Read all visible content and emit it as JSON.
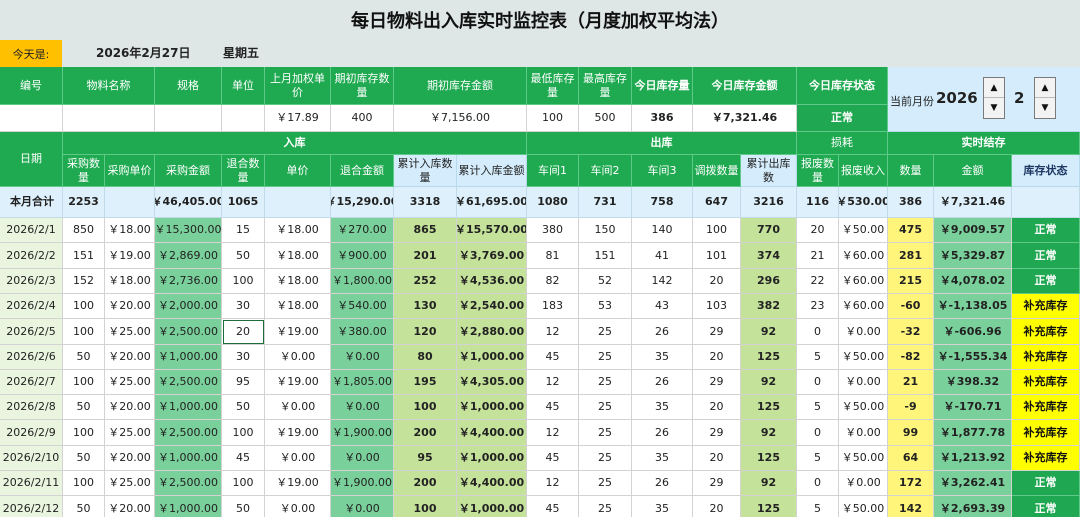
{
  "title": "每日物料出入库实时监控表（月度加权平均法）",
  "today": {
    "label": "今天是:",
    "date": "2026年2月27日",
    "weekday": "星期五"
  },
  "info_header": [
    "编号",
    "物料名称",
    "规格",
    "单位",
    "上月加权单价",
    "期初库存数量",
    "期初库存金额",
    "最低库存量",
    "最高库存量",
    "今日库存量",
    "今日库存金额",
    "今日库存状态"
  ],
  "info_values": [
    "",
    "",
    "",
    "",
    "￥17.89",
    "400",
    "￥7,156.00",
    "100",
    "500",
    "386",
    "￥7,321.46",
    "正常"
  ],
  "month_panel": {
    "label": "当前月份",
    "year": "2026",
    "month": "2",
    "up_icon": "spin-up-icon",
    "down_icon": "spin-down-icon"
  },
  "groups": {
    "date": "日期",
    "inbound": "入库",
    "outbound": "出库",
    "loss": "损耗",
    "stock": "实时结存"
  },
  "sub_header": [
    "采购数量",
    "采购单价",
    "采购金额",
    "退合数量",
    "单价",
    "退合金额",
    "累计入库数量",
    "累计入库金额",
    "车间1",
    "车间2",
    "车间3",
    "调拨数量",
    "累计出库数",
    "报废数量",
    "报废收入",
    "数量",
    "金额",
    "库存状态"
  ],
  "total_row": [
    "本月合计",
    "2253",
    "",
    "￥46,405.00",
    "1065",
    "",
    "￥15,290.00",
    "3318",
    "￥61,695.00",
    "1080",
    "731",
    "758",
    "647",
    "3216",
    "116",
    "￥530.00",
    "386",
    "￥7,321.46",
    ""
  ],
  "rows": [
    [
      "2026/2/1",
      "850",
      "￥18.00",
      "￥15,300.00",
      "15",
      "￥18.00",
      "￥270.00",
      "865",
      "￥15,570.00",
      "380",
      "150",
      "140",
      "100",
      "770",
      "20",
      "￥50.00",
      "475",
      "￥9,009.57",
      "正常"
    ],
    [
      "2026/2/2",
      "151",
      "￥19.00",
      "￥2,869.00",
      "50",
      "￥18.00",
      "￥900.00",
      "201",
      "￥3,769.00",
      "81",
      "151",
      "41",
      "101",
      "374",
      "21",
      "￥60.00",
      "281",
      "￥5,329.87",
      "正常"
    ],
    [
      "2026/2/3",
      "152",
      "￥18.00",
      "￥2,736.00",
      "100",
      "￥18.00",
      "￥1,800.00",
      "252",
      "￥4,536.00",
      "82",
      "52",
      "142",
      "20",
      "296",
      "22",
      "￥60.00",
      "215",
      "￥4,078.02",
      "正常"
    ],
    [
      "2026/2/4",
      "100",
      "￥20.00",
      "￥2,000.00",
      "30",
      "￥18.00",
      "￥540.00",
      "130",
      "￥2,540.00",
      "183",
      "53",
      "43",
      "103",
      "382",
      "23",
      "￥60.00",
      "-60",
      "￥-1,138.05",
      "补充库存"
    ],
    [
      "2026/2/5",
      "100",
      "￥25.00",
      "￥2,500.00",
      "20",
      "￥19.00",
      "￥380.00",
      "120",
      "￥2,880.00",
      "12",
      "25",
      "26",
      "29",
      "92",
      "0",
      "￥0.00",
      "-32",
      "￥-606.96",
      "补充库存"
    ],
    [
      "2026/2/6",
      "50",
      "￥20.00",
      "￥1,000.00",
      "30",
      "￥0.00",
      "￥0.00",
      "80",
      "￥1,000.00",
      "45",
      "25",
      "35",
      "20",
      "125",
      "5",
      "￥50.00",
      "-82",
      "￥-1,555.34",
      "补充库存"
    ],
    [
      "2026/2/7",
      "100",
      "￥25.00",
      "￥2,500.00",
      "95",
      "￥19.00",
      "￥1,805.00",
      "195",
      "￥4,305.00",
      "12",
      "25",
      "26",
      "29",
      "92",
      "0",
      "￥0.00",
      "21",
      "￥398.32",
      "补充库存"
    ],
    [
      "2026/2/8",
      "50",
      "￥20.00",
      "￥1,000.00",
      "50",
      "￥0.00",
      "￥0.00",
      "100",
      "￥1,000.00",
      "45",
      "25",
      "35",
      "20",
      "125",
      "5",
      "￥50.00",
      "-9",
      "￥-170.71",
      "补充库存"
    ],
    [
      "2026/2/9",
      "100",
      "￥25.00",
      "￥2,500.00",
      "100",
      "￥19.00",
      "￥1,900.00",
      "200",
      "￥4,400.00",
      "12",
      "25",
      "26",
      "29",
      "92",
      "0",
      "￥0.00",
      "99",
      "￥1,877.78",
      "补充库存"
    ],
    [
      "2026/2/10",
      "50",
      "￥20.00",
      "￥1,000.00",
      "45",
      "￥0.00",
      "￥0.00",
      "95",
      "￥1,000.00",
      "45",
      "25",
      "35",
      "20",
      "125",
      "5",
      "￥50.00",
      "64",
      "￥1,213.92",
      "补充库存"
    ],
    [
      "2026/2/11",
      "100",
      "￥25.00",
      "￥2,500.00",
      "100",
      "￥19.00",
      "￥1,900.00",
      "200",
      "￥4,400.00",
      "12",
      "25",
      "26",
      "29",
      "92",
      "0",
      "￥0.00",
      "172",
      "￥3,262.41",
      "正常"
    ],
    [
      "2026/2/12",
      "50",
      "￥20.00",
      "￥1,000.00",
      "50",
      "￥0.00",
      "￥0.00",
      "100",
      "￥1,000.00",
      "45",
      "25",
      "35",
      "20",
      "125",
      "5",
      "￥50.00",
      "142",
      "￥2,693.39",
      "正常"
    ]
  ],
  "colors": {
    "header_green": "#1faa51",
    "light_blue": "#d4ecfb",
    "mid_green": "#79d09a",
    "lime": "#c5e29b",
    "yellow": "#fff57a",
    "alert_yellow": "#ffff00",
    "today_orange": "#ffc000"
  },
  "selected_cell": "2026/2/5 退合数量"
}
